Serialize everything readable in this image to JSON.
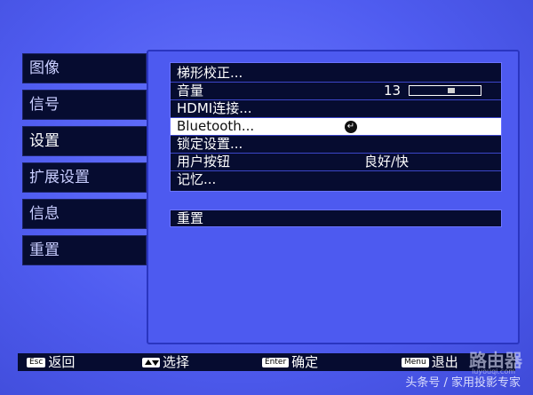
{
  "sidebar": {
    "items": [
      {
        "label": "图像"
      },
      {
        "label": "信号"
      },
      {
        "label": "设置"
      },
      {
        "label": "扩展设置"
      },
      {
        "label": "信息"
      },
      {
        "label": "重置"
      }
    ]
  },
  "menu": {
    "rows": [
      {
        "label": "梯形校正..."
      },
      {
        "label": "音量",
        "value": "13"
      },
      {
        "label": "HDMI连接..."
      },
      {
        "label": "Bluetooth..."
      },
      {
        "label": "锁定设置..."
      },
      {
        "label": "用户按钮",
        "value": "良好/快"
      },
      {
        "label": "记忆..."
      }
    ],
    "volume_level": 0.6
  },
  "reset": {
    "label": "重置"
  },
  "bottom": {
    "esc_key": "Esc",
    "esc_label": "返回",
    "select_label": "选择",
    "enter_key": "Enter",
    "enter_label": "确定",
    "menu_key": "Menu",
    "menu_label": "退出"
  },
  "watermark": {
    "text": "头条号 / 家用投影专家",
    "logo": "路由器",
    "url": "luyouqi.com"
  }
}
